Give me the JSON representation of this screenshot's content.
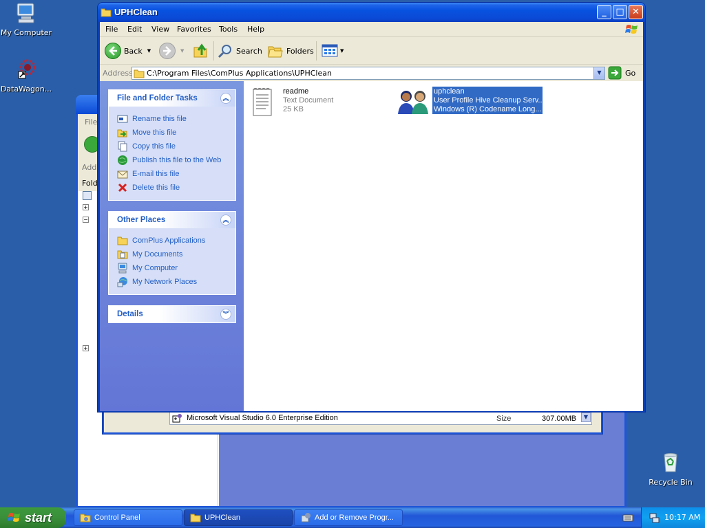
{
  "desktop": {
    "icons": [
      {
        "label": "My Computer"
      },
      {
        "label": "DataWagon..."
      },
      {
        "label": "Recycle Bin"
      }
    ]
  },
  "background_window": {
    "menu_partial": "File",
    "address_partial": "Add",
    "folders_partial": "Fold",
    "row_name": "Microsoft Visual Studio 6.0 Enterprise Edition",
    "row_size_label": "Size",
    "row_size_value": "307.00MB"
  },
  "window": {
    "title": "UPHClean",
    "menu": [
      "File",
      "Edit",
      "View",
      "Favorites",
      "Tools",
      "Help"
    ],
    "toolbar": {
      "back": "Back",
      "search": "Search",
      "folders": "Folders"
    },
    "address": {
      "label": "Address",
      "value": "C:\\Program Files\\ComPlus Applications\\UPHClean",
      "go": "Go"
    }
  },
  "tasks_panel": {
    "title": "File and Folder Tasks",
    "items": [
      {
        "label": "Rename this file",
        "icon": "rename-icon"
      },
      {
        "label": "Move this file",
        "icon": "move-icon"
      },
      {
        "label": "Copy this file",
        "icon": "copy-icon"
      },
      {
        "label": "Publish this file to the Web",
        "icon": "publish-icon"
      },
      {
        "label": "E-mail this file",
        "icon": "email-icon"
      },
      {
        "label": "Delete this file",
        "icon": "delete-icon"
      }
    ]
  },
  "places_panel": {
    "title": "Other Places",
    "items": [
      {
        "label": "ComPlus Applications",
        "icon": "folder-icon"
      },
      {
        "label": "My Documents",
        "icon": "documents-icon"
      },
      {
        "label": "My Computer",
        "icon": "computer-icon"
      },
      {
        "label": "My Network Places",
        "icon": "network-icon"
      }
    ]
  },
  "details_panel": {
    "title": "Details"
  },
  "files": [
    {
      "name": "readme",
      "type": "Text Document",
      "size": "25 KB",
      "icon": "text-document-icon"
    },
    {
      "name": "uphclean",
      "type": "User Profile Hive Cleanup Serv...",
      "size": "Windows (R) Codename Long...",
      "icon": "users-icon",
      "selected": true
    }
  ],
  "taskbar": {
    "start": "start",
    "tasks": [
      {
        "label": "Control Panel"
      },
      {
        "label": "UPHClean",
        "active": true
      },
      {
        "label": "Add or Remove Progr..."
      }
    ],
    "clock": "10:17 AM"
  },
  "colors": {
    "desktop": "#2a5ea8",
    "titlebar": "#0852e0",
    "selection": "#316ac5",
    "link": "#215dc6"
  }
}
